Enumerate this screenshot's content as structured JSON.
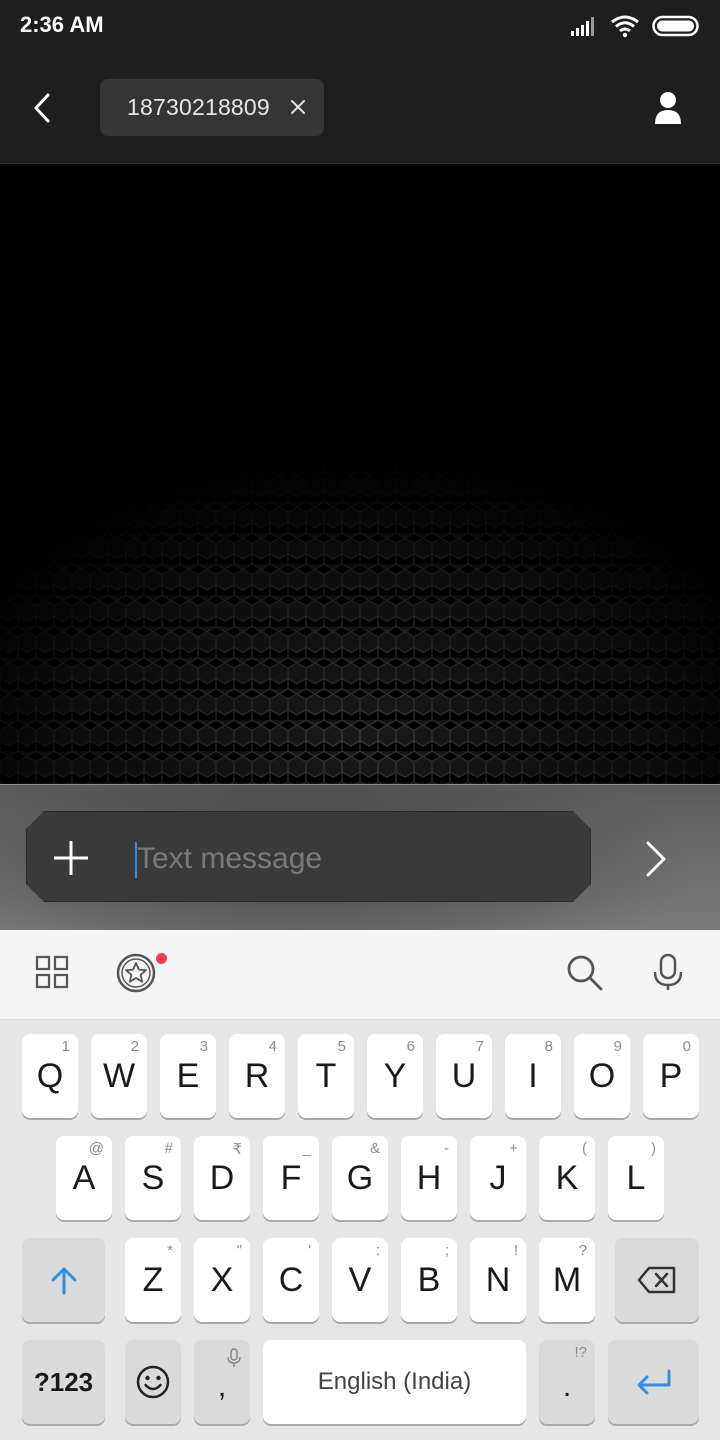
{
  "status_bar": {
    "time": "2:36 AM"
  },
  "header": {
    "recipient": "18730218809"
  },
  "compose": {
    "placeholder": "Text message"
  },
  "keyboard": {
    "row1": [
      {
        "key": "Q",
        "hint": "1"
      },
      {
        "key": "W",
        "hint": "2"
      },
      {
        "key": "E",
        "hint": "3"
      },
      {
        "key": "R",
        "hint": "4"
      },
      {
        "key": "T",
        "hint": "5"
      },
      {
        "key": "Y",
        "hint": "6"
      },
      {
        "key": "U",
        "hint": "7"
      },
      {
        "key": "I",
        "hint": "8"
      },
      {
        "key": "O",
        "hint": "9"
      },
      {
        "key": "P",
        "hint": "0"
      }
    ],
    "row2": [
      {
        "key": "A",
        "hint": "@"
      },
      {
        "key": "S",
        "hint": "#"
      },
      {
        "key": "D",
        "hint": "₹"
      },
      {
        "key": "F",
        "hint": "_"
      },
      {
        "key": "G",
        "hint": "&"
      },
      {
        "key": "H",
        "hint": "-"
      },
      {
        "key": "J",
        "hint": "+"
      },
      {
        "key": "K",
        "hint": "("
      },
      {
        "key": "L",
        "hint": ")"
      }
    ],
    "row3": [
      {
        "key": "Z",
        "hint": "*"
      },
      {
        "key": "X",
        "hint": "\""
      },
      {
        "key": "C",
        "hint": "'"
      },
      {
        "key": "V",
        "hint": ":"
      },
      {
        "key": "B",
        "hint": ";"
      },
      {
        "key": "N",
        "hint": "!"
      },
      {
        "key": "M",
        "hint": "?"
      }
    ],
    "symbols_label": "?123",
    "comma_label": ",",
    "space_label": "English (India)",
    "period_label": ".",
    "period_hint": "!?"
  },
  "colors": {
    "accent": "#2e8de6",
    "notification": "#f2404a"
  }
}
